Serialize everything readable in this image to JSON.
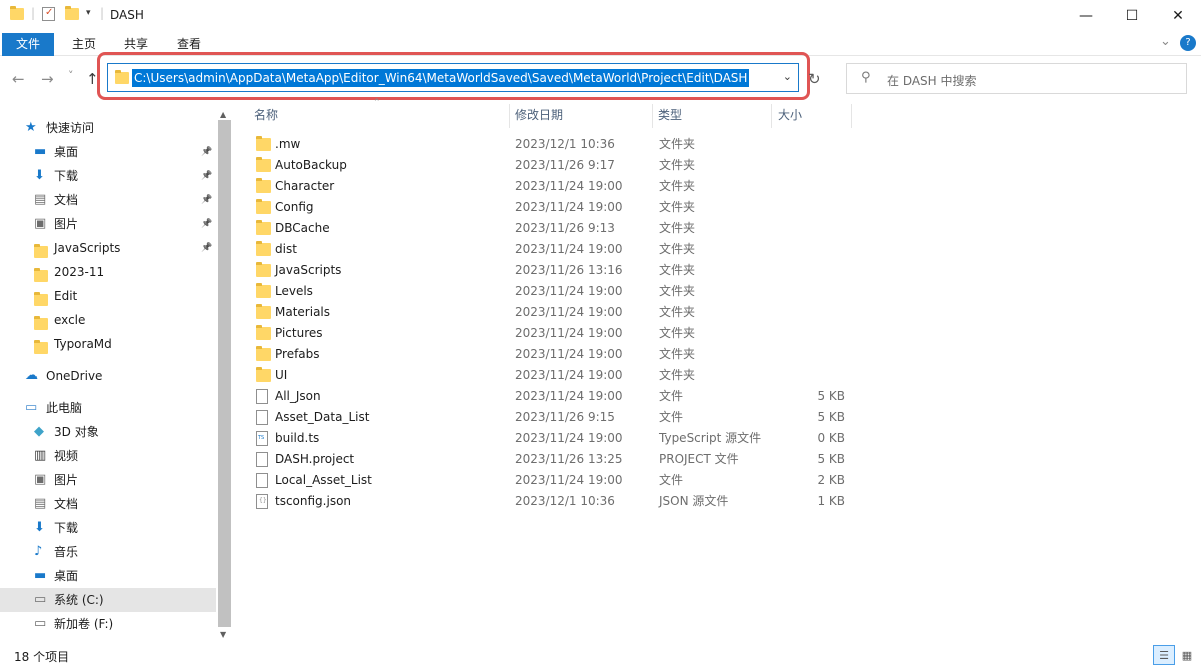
{
  "window": {
    "title": "DASH",
    "minimize": "—",
    "maximize": "☐",
    "close": "✕"
  },
  "ribbon": {
    "tabs": [
      "文件",
      "主页",
      "共享",
      "查看"
    ],
    "expand": "⌄",
    "help": "?"
  },
  "nav": {
    "back": "←",
    "forward": "→",
    "recent": "˅",
    "up": "↑",
    "address": "C:\\Users\\admin\\AppData\\MetaApp\\Editor_Win64\\MetaWorldSaved\\Saved\\MetaWorld\\Project\\Edit\\DASH",
    "dropdown": "⌄",
    "refresh": "↻",
    "search_placeholder": "在 DASH 中搜索"
  },
  "sidebar": {
    "items": [
      {
        "label": "快速访问",
        "icon": "star-icon",
        "level": 0,
        "pinned": false
      },
      {
        "label": "桌面",
        "icon": "desktop-icon",
        "level": 1,
        "pinned": true
      },
      {
        "label": "下载",
        "icon": "download-icon",
        "level": 1,
        "pinned": true
      },
      {
        "label": "文档",
        "icon": "document-icon",
        "level": 1,
        "pinned": true
      },
      {
        "label": "图片",
        "icon": "picture-icon",
        "level": 1,
        "pinned": true
      },
      {
        "label": "JavaScripts",
        "icon": "folder-icon",
        "level": 1,
        "pinned": true
      },
      {
        "label": "2023-11",
        "icon": "folder-icon",
        "level": 1,
        "pinned": false
      },
      {
        "label": "Edit",
        "icon": "folder-icon",
        "level": 1,
        "pinned": false
      },
      {
        "label": "excle",
        "icon": "folder-icon",
        "level": 1,
        "pinned": false
      },
      {
        "label": "TyporaMd",
        "icon": "folder-icon",
        "level": 1,
        "pinned": false
      },
      {
        "label": "OneDrive",
        "icon": "cloud-icon",
        "level": 0,
        "pinned": false
      },
      {
        "label": "此电脑",
        "icon": "computer-icon",
        "level": 0,
        "pinned": false
      },
      {
        "label": "3D 对象",
        "icon": "cube-icon",
        "level": 1,
        "pinned": false
      },
      {
        "label": "视频",
        "icon": "video-icon",
        "level": 1,
        "pinned": false
      },
      {
        "label": "图片",
        "icon": "picture-icon",
        "level": 1,
        "pinned": false
      },
      {
        "label": "文档",
        "icon": "document-icon",
        "level": 1,
        "pinned": false
      },
      {
        "label": "下载",
        "icon": "download-icon",
        "level": 1,
        "pinned": false
      },
      {
        "label": "音乐",
        "icon": "music-icon",
        "level": 1,
        "pinned": false
      },
      {
        "label": "桌面",
        "icon": "desktop-icon",
        "level": 1,
        "pinned": false
      },
      {
        "label": "系统 (C:)",
        "icon": "drive-icon",
        "level": 1,
        "pinned": false,
        "selected": true
      },
      {
        "label": "新加卷 (F:)",
        "icon": "drive-icon",
        "level": 1,
        "pinned": false
      }
    ]
  },
  "columns": {
    "name": "名称",
    "date": "修改日期",
    "type": "类型",
    "size": "大小"
  },
  "files": [
    {
      "name": ".mw",
      "date": "2023/12/1 10:36",
      "type": "文件夹",
      "size": "",
      "kind": "folder"
    },
    {
      "name": "AutoBackup",
      "date": "2023/11/26 9:17",
      "type": "文件夹",
      "size": "",
      "kind": "folder"
    },
    {
      "name": "Character",
      "date": "2023/11/24 19:00",
      "type": "文件夹",
      "size": "",
      "kind": "folder"
    },
    {
      "name": "Config",
      "date": "2023/11/24 19:00",
      "type": "文件夹",
      "size": "",
      "kind": "folder"
    },
    {
      "name": "DBCache",
      "date": "2023/11/26 9:13",
      "type": "文件夹",
      "size": "",
      "kind": "folder"
    },
    {
      "name": "dist",
      "date": "2023/11/24 19:00",
      "type": "文件夹",
      "size": "",
      "kind": "folder"
    },
    {
      "name": "JavaScripts",
      "date": "2023/11/26 13:16",
      "type": "文件夹",
      "size": "",
      "kind": "folder"
    },
    {
      "name": "Levels",
      "date": "2023/11/24 19:00",
      "type": "文件夹",
      "size": "",
      "kind": "folder"
    },
    {
      "name": "Materials",
      "date": "2023/11/24 19:00",
      "type": "文件夹",
      "size": "",
      "kind": "folder"
    },
    {
      "name": "Pictures",
      "date": "2023/11/24 19:00",
      "type": "文件夹",
      "size": "",
      "kind": "folder"
    },
    {
      "name": "Prefabs",
      "date": "2023/11/24 19:00",
      "type": "文件夹",
      "size": "",
      "kind": "folder"
    },
    {
      "name": "UI",
      "date": "2023/11/24 19:00",
      "type": "文件夹",
      "size": "",
      "kind": "folder"
    },
    {
      "name": "All_Json",
      "date": "2023/11/24 19:00",
      "type": "文件",
      "size": "5 KB",
      "kind": "file"
    },
    {
      "name": "Asset_Data_List",
      "date": "2023/11/26 9:15",
      "type": "文件",
      "size": "5 KB",
      "kind": "file"
    },
    {
      "name": "build.ts",
      "date": "2023/11/24 19:00",
      "type": "TypeScript 源文件",
      "size": "0 KB",
      "kind": "ts"
    },
    {
      "name": "DASH.project",
      "date": "2023/11/26 13:25",
      "type": "PROJECT 文件",
      "size": "5 KB",
      "kind": "file"
    },
    {
      "name": "Local_Asset_List",
      "date": "2023/11/24 19:00",
      "type": "文件",
      "size": "2 KB",
      "kind": "file"
    },
    {
      "name": "tsconfig.json",
      "date": "2023/12/1 10:36",
      "type": "JSON 源文件",
      "size": "1 KB",
      "kind": "json"
    }
  ],
  "status": {
    "count": "18 个项目"
  }
}
